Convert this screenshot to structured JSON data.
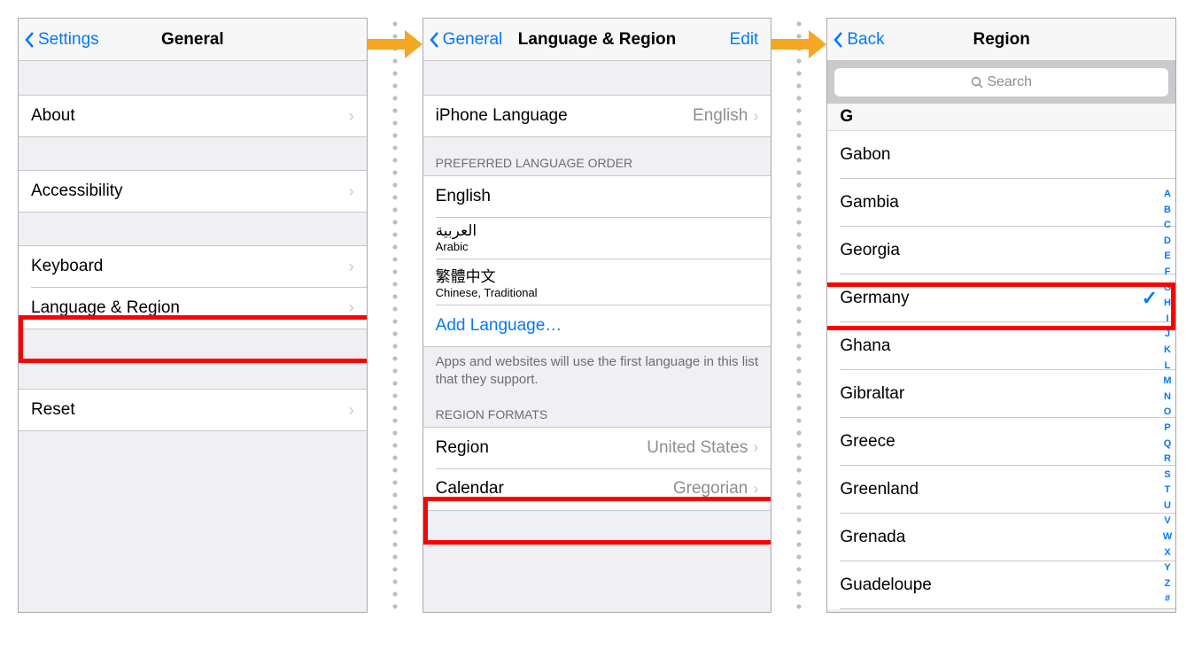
{
  "panel1": {
    "nav": {
      "back": "Settings",
      "title": "General"
    },
    "items": {
      "about": "About",
      "accessibility": "Accessibility",
      "keyboard": "Keyboard",
      "language_region": "Language & Region",
      "reset": "Reset"
    }
  },
  "panel2": {
    "nav": {
      "back": "General",
      "title": "Language & Region",
      "edit": "Edit"
    },
    "iphone_language": {
      "label": "iPhone Language",
      "value": "English"
    },
    "preferred_header": "PREFERRED LANGUAGE ORDER",
    "languages": [
      {
        "label": "English",
        "sub": ""
      },
      {
        "label": "العربية",
        "sub": "Arabic"
      },
      {
        "label": "繁體中文",
        "sub": "Chinese, Traditional"
      }
    ],
    "add_language": "Add Language…",
    "footer": "Apps and websites will use the first language in this list that they support.",
    "region_formats_header": "REGION FORMATS",
    "region": {
      "label": "Region",
      "value": "United States"
    },
    "calendar": {
      "label": "Calendar",
      "value": "Gregorian"
    }
  },
  "panel3": {
    "nav": {
      "back": "Back",
      "title": "Region"
    },
    "search_placeholder": "Search",
    "section_letter": "G",
    "countries": [
      {
        "name": "Gabon",
        "selected": false
      },
      {
        "name": "Gambia",
        "selected": false
      },
      {
        "name": "Georgia",
        "selected": false
      },
      {
        "name": "Germany",
        "selected": true
      },
      {
        "name": "Ghana",
        "selected": false
      },
      {
        "name": "Gibraltar",
        "selected": false
      },
      {
        "name": "Greece",
        "selected": false
      },
      {
        "name": "Greenland",
        "selected": false
      },
      {
        "name": "Grenada",
        "selected": false
      },
      {
        "name": "Guadeloupe",
        "selected": false
      }
    ],
    "index_letters": [
      "A",
      "B",
      "C",
      "D",
      "E",
      "F",
      "G",
      "H",
      "I",
      "J",
      "K",
      "L",
      "M",
      "N",
      "O",
      "P",
      "Q",
      "R",
      "S",
      "T",
      "U",
      "V",
      "W",
      "X",
      "Y",
      "Z",
      "#"
    ]
  }
}
